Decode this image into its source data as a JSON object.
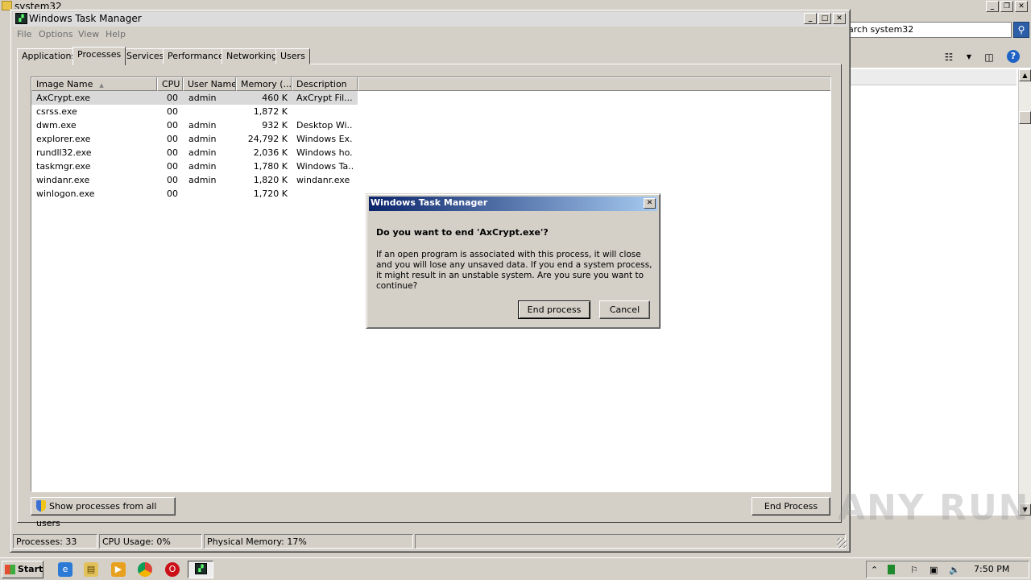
{
  "explorer": {
    "title": "system32",
    "search_text": "arch system32"
  },
  "task_manager": {
    "title": "Windows Task Manager",
    "menu": [
      "File",
      "Options",
      "View",
      "Help"
    ],
    "tabs": [
      "Applications",
      "Processes",
      "Services",
      "Performance",
      "Networking",
      "Users"
    ],
    "active_tab": "Processes",
    "columns": [
      "Image Name",
      "CPU",
      "User Name",
      "Memory (...",
      "Description"
    ],
    "processes": [
      {
        "name": "AxCrypt.exe",
        "cpu": "00",
        "user": "admin",
        "memory": "460 K",
        "description": "AxCrypt Fil..."
      },
      {
        "name": "csrss.exe",
        "cpu": "00",
        "user": "",
        "memory": "1,872 K",
        "description": ""
      },
      {
        "name": "dwm.exe",
        "cpu": "00",
        "user": "admin",
        "memory": "932 K",
        "description": "Desktop Wi..."
      },
      {
        "name": "explorer.exe",
        "cpu": "00",
        "user": "admin",
        "memory": "24,792 K",
        "description": "Windows Ex..."
      },
      {
        "name": "rundll32.exe",
        "cpu": "00",
        "user": "admin",
        "memory": "2,036 K",
        "description": "Windows ho..."
      },
      {
        "name": "taskmgr.exe",
        "cpu": "00",
        "user": "admin",
        "memory": "1,780 K",
        "description": "Windows Ta..."
      },
      {
        "name": "windanr.exe",
        "cpu": "00",
        "user": "admin",
        "memory": "1,820 K",
        "description": "windanr.exe"
      },
      {
        "name": "winlogon.exe",
        "cpu": "00",
        "user": "",
        "memory": "1,720 K",
        "description": ""
      }
    ],
    "selected_row": 0,
    "show_all_label": "Show processes from all users",
    "end_process_label": "End Process",
    "status": {
      "processes": "Processes: 33",
      "cpu": "CPU Usage: 0%",
      "memory": "Physical Memory: 17%"
    }
  },
  "dialog": {
    "title": "Windows Task Manager",
    "heading": "Do you want to end 'AxCrypt.exe'?",
    "body": "If an open program is associated with this process, it will close and you will lose any unsaved data. If you end a system process, it might result in an unstable system. Are you sure you want to continue?",
    "confirm_label": "End process",
    "cancel_label": "Cancel"
  },
  "watermark": "ANY RUN",
  "taskbar": {
    "start_label": "Start",
    "clock": "7:50 PM"
  },
  "colors": {
    "dialog_title_start": "#0a246a",
    "dialog_title_end": "#a6caf0",
    "window_face": "#d4d0c8"
  }
}
